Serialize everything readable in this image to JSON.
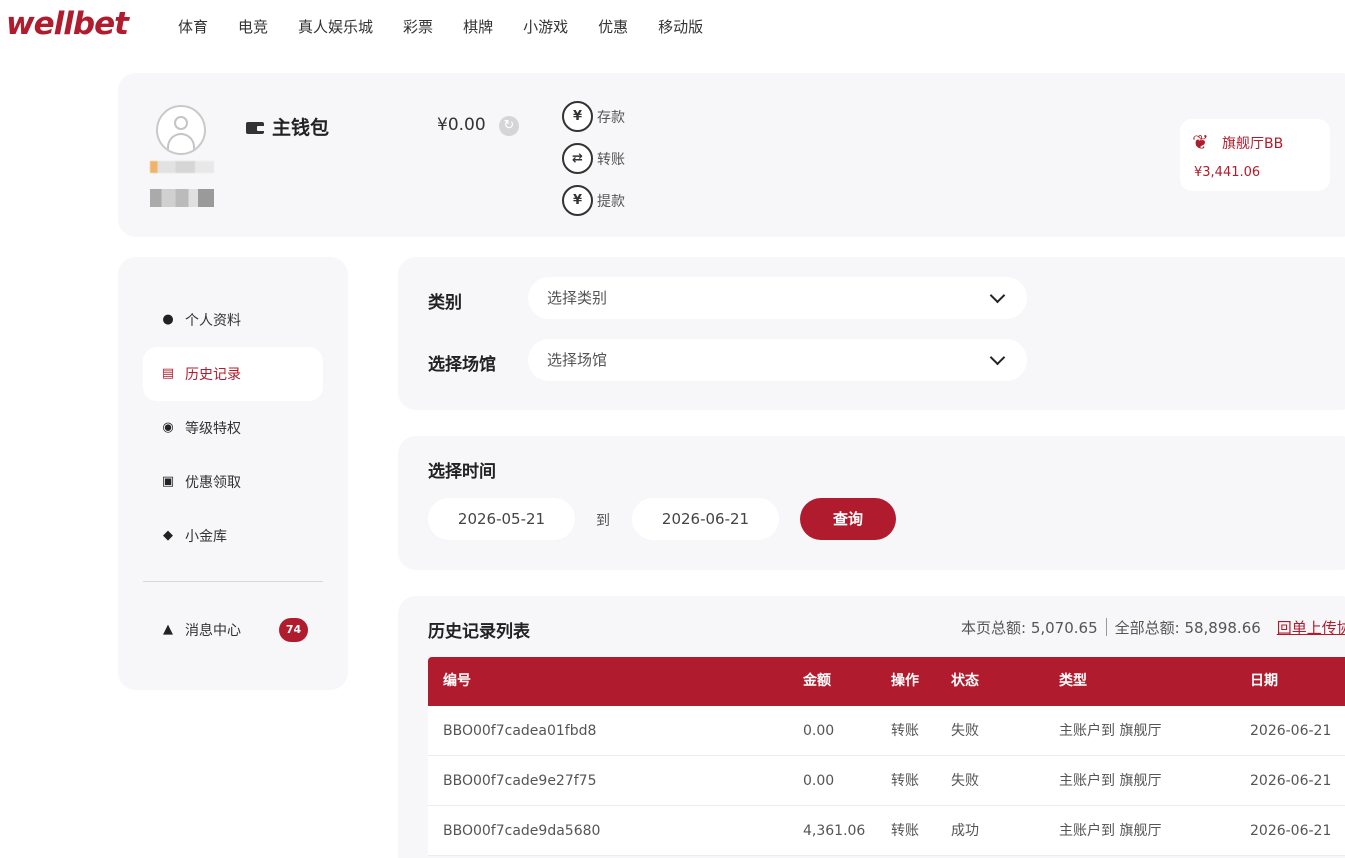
{
  "brand": {
    "logo_text": "wellbet",
    "accent": "#b01c2e"
  },
  "nav": {
    "items": [
      "体育",
      "电竞",
      "真人娱乐城",
      "彩票",
      "棋牌",
      "小游戏",
      "优惠",
      "移动版"
    ]
  },
  "wallet": {
    "title": "主钱包",
    "balance": "¥0.00",
    "refresh_icon": "refresh-icon",
    "actions": [
      {
        "label": "存款",
        "icon": "deposit-icon",
        "glyph": "¥"
      },
      {
        "label": "转账",
        "icon": "transfer-icon",
        "glyph": "⇄"
      },
      {
        "label": "提款",
        "icon": "withdraw-icon",
        "glyph": "¥"
      }
    ],
    "flagship": {
      "name": "旗舰厅BB",
      "amount": "¥3,441.06",
      "icon": "wing-logo-icon"
    }
  },
  "sidebar": {
    "items": [
      {
        "label": "个人资料",
        "icon": "user-icon",
        "glyph": "👤",
        "active": false
      },
      {
        "label": "历史记录",
        "icon": "document-icon",
        "glyph": "▤",
        "active": true
      },
      {
        "label": "等级特权",
        "icon": "medal-icon",
        "glyph": "◉",
        "active": false
      },
      {
        "label": "优惠领取",
        "icon": "gift-icon",
        "glyph": "🎁",
        "active": false
      },
      {
        "label": "小金库",
        "icon": "diamond-icon",
        "glyph": "◆",
        "active": false
      }
    ],
    "messages": {
      "label": "消息中心",
      "icon": "bell-icon",
      "glyph": "🔔",
      "count": "74"
    }
  },
  "filters": {
    "category": {
      "label": "类别",
      "placeholder": "选择类别"
    },
    "venue": {
      "label": "选择场馆",
      "placeholder": "选择场馆"
    },
    "time": {
      "label": "选择时间",
      "start": "2026-05-21",
      "to": "到",
      "end": "2026-06-21",
      "query_label": "查询"
    }
  },
  "history": {
    "title": "历史记录列表",
    "page_total": "本页总额: 5,070.65",
    "all_total": "全部总额: 58,898.66",
    "upload_link": "回单上传协",
    "columns": [
      "编号",
      "金额",
      "操作",
      "状态",
      "类型",
      "日期"
    ],
    "rows": [
      [
        "BBO00f7cadea01fbd8",
        "0.00",
        "转账",
        "失败",
        "主账户到 旗舰厅",
        "2026-06-21"
      ],
      [
        "BBO00f7cade9e27f75",
        "0.00",
        "转账",
        "失败",
        "主账户到 旗舰厅",
        "2026-06-21"
      ],
      [
        "BBO00f7cade9da5680",
        "4,361.06",
        "转账",
        "成功",
        "主账户到 旗舰厅",
        "2026-06-21"
      ]
    ]
  }
}
